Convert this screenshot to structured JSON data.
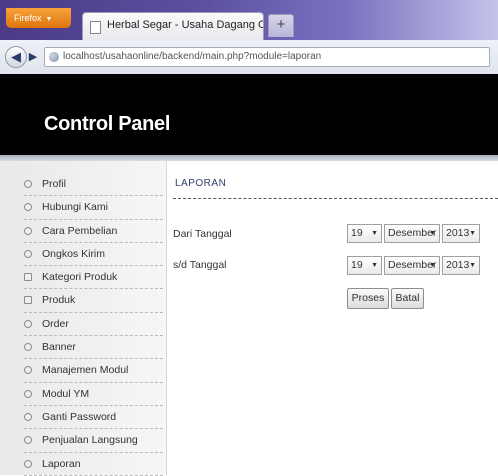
{
  "browser": {
    "app_button": "Firefox",
    "tab_title": "Herbal Segar - Usaha Dagang Online",
    "new_tab": "+",
    "url": "localhost/usahaonline/backend/main.php?module=laporan"
  },
  "header": {
    "title": "Control Panel"
  },
  "sidebar": {
    "items": [
      {
        "label": "Profil"
      },
      {
        "label": "Hubungi Kami"
      },
      {
        "label": "Cara Pembelian"
      },
      {
        "label": "Ongkos Kirim"
      },
      {
        "label": "Kategori Produk"
      },
      {
        "label": "Produk"
      },
      {
        "label": "Order"
      },
      {
        "label": "Banner"
      },
      {
        "label": "Manajemen Modul"
      },
      {
        "label": "Modul YM"
      },
      {
        "label": "Ganti Password"
      },
      {
        "label": "Penjualan Langsung"
      },
      {
        "label": "Laporan"
      }
    ]
  },
  "main": {
    "section_title": "LAPORAN",
    "from": {
      "label": "Dari Tanggal",
      "day": "19",
      "month": "Desember",
      "year": "2013"
    },
    "to": {
      "label": "s/d Tanggal",
      "day": "19",
      "month": "Desember",
      "year": "2013"
    },
    "submit_label": "Proses",
    "cancel_label": "Batal"
  }
}
